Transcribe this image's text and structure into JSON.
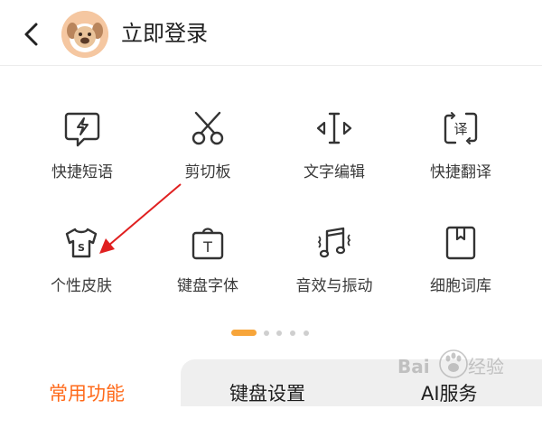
{
  "header": {
    "back_icon": "chevron-left-icon",
    "login_label": "立即登录"
  },
  "grid": [
    {
      "label": "快捷短语",
      "icon": "lightning-bubble-icon"
    },
    {
      "label": "剪切板",
      "icon": "scissors-icon"
    },
    {
      "label": "文字编辑",
      "icon": "text-cursor-icon"
    },
    {
      "label": "快捷翻译",
      "icon": "translate-icon"
    },
    {
      "label": "个性皮肤",
      "icon": "tshirt-icon"
    },
    {
      "label": "键盘字体",
      "icon": "font-bag-icon"
    },
    {
      "label": "音效与振动",
      "icon": "music-vibrate-icon"
    },
    {
      "label": "细胞词库",
      "icon": "book-icon"
    }
  ],
  "pager": {
    "pages": 5,
    "active_page": 1
  },
  "tabs": [
    {
      "label": "常用功能",
      "active": true
    },
    {
      "label": "键盘设置",
      "active": false
    },
    {
      "label": "AI服务",
      "active": false
    }
  ],
  "colors": {
    "accent": "#ff6a1a",
    "annotation_arrow": "#e02020",
    "pager_active": "#f7a53a"
  },
  "watermark": {
    "text": "Baidu 经验"
  }
}
